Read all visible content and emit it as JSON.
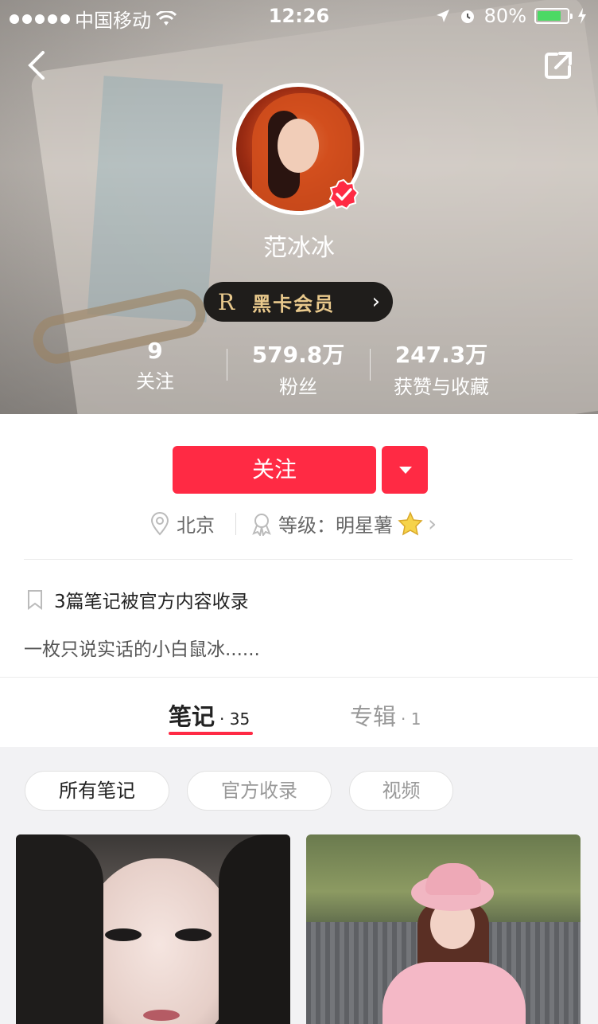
{
  "status_bar": {
    "carrier": "中国移动",
    "time": "12:26",
    "battery_percent": "80%",
    "battery_level": 0.8
  },
  "profile": {
    "name": "范冰冰",
    "vip": {
      "badge": "R",
      "label": "黑卡会员"
    },
    "stats": [
      {
        "value": "9",
        "label": "关注"
      },
      {
        "value": "579.8万",
        "label": "粉丝"
      },
      {
        "value": "247.3万",
        "label": "获赞与收藏"
      }
    ],
    "follow_label": "关注",
    "location": "北京",
    "level_label": "等级：明星薯",
    "collected_text": "3篇笔记被官方内容收录",
    "bio": "一枚只说实话的小白鼠冰......"
  },
  "tabs": [
    {
      "label": "笔记",
      "count": "· 35",
      "active": true
    },
    {
      "label": "专辑",
      "count": "· 1",
      "active": false
    }
  ],
  "filters": [
    "所有笔记",
    "官方收录",
    "视频"
  ],
  "icons": {
    "back": "chevron-left-icon",
    "share": "share-icon",
    "verified": "verified-badge-icon",
    "location": "location-pin-icon",
    "level": "award-icon",
    "star": "star-icon",
    "bookmark": "bookmark-icon"
  },
  "colors": {
    "accent": "#ff2a44",
    "vip_gold": "#e9c98c"
  }
}
